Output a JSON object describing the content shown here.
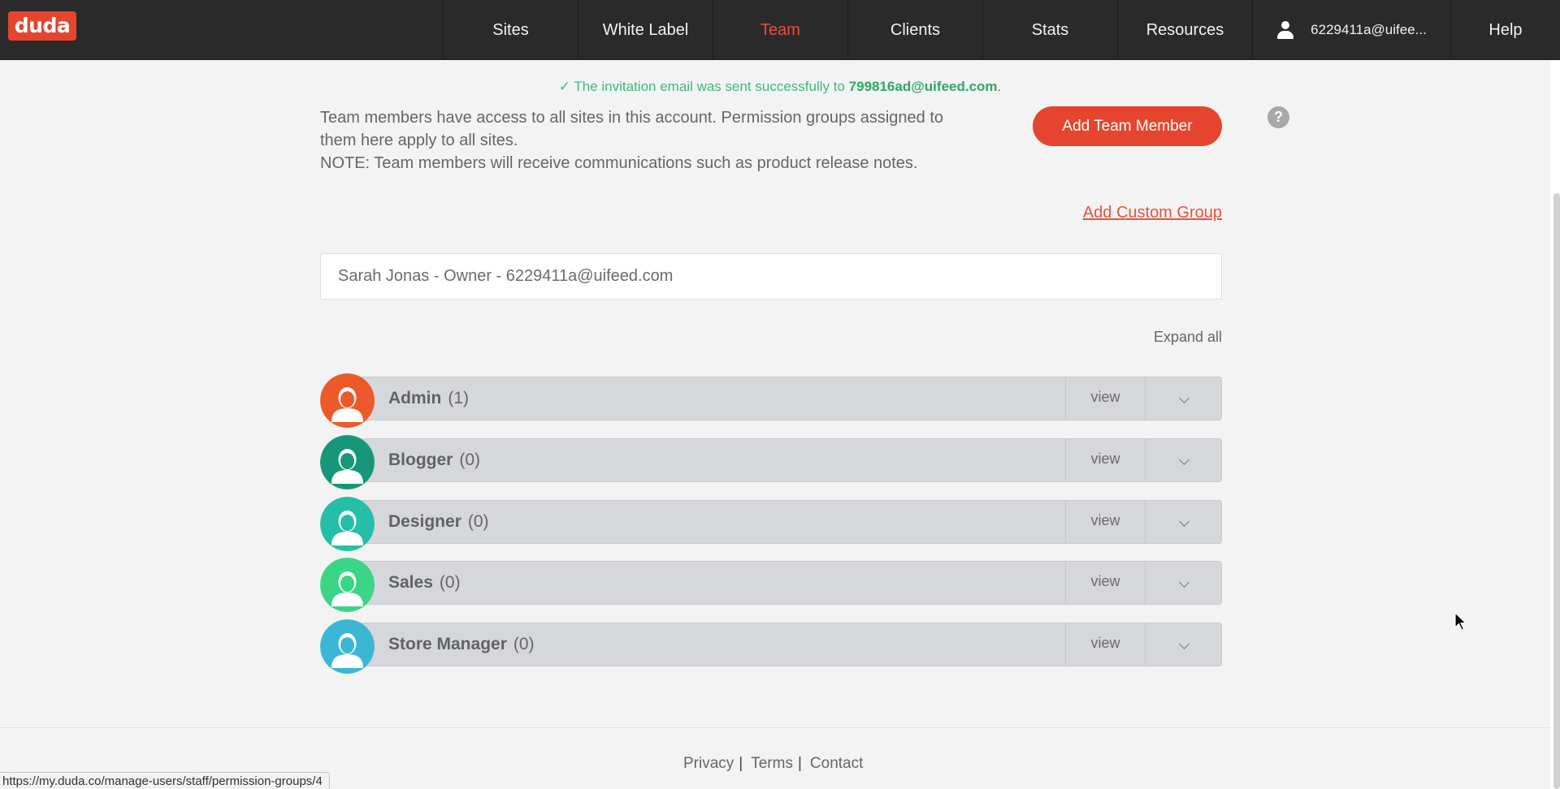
{
  "header": {
    "logo": "duda",
    "nav": [
      {
        "label": "Sites",
        "active": false
      },
      {
        "label": "White Label",
        "active": false
      },
      {
        "label": "Team",
        "active": true
      },
      {
        "label": "Clients",
        "active": false
      },
      {
        "label": "Stats",
        "active": false
      },
      {
        "label": "Resources",
        "active": false
      }
    ],
    "user_email": "6229411a@uifee...",
    "help_label": "Help",
    "user_icon": "user-icon"
  },
  "notice": {
    "check": "✓",
    "text": "The invitation email was sent successfully to ",
    "email": "799816ad@uifeed.com",
    "period": "."
  },
  "intro": {
    "line1": "Team members have access to all sites in this account. Permission groups assigned to them here apply to all sites.",
    "line2": "NOTE: Team members will receive communications such as product release notes."
  },
  "actions": {
    "add_team_member": "Add Team Member",
    "help_icon": "?",
    "add_custom_group": "Add Custom Group",
    "expand_all": "Expand all"
  },
  "owner": {
    "text": "Sarah Jonas - Owner - 6229411a@uifeed.com"
  },
  "groups": [
    {
      "name": "Admin",
      "count": "(1)",
      "view": "view",
      "color": "#ec5a2a"
    },
    {
      "name": "Blogger",
      "count": "(0)",
      "view": "view",
      "color": "#17977a"
    },
    {
      "name": "Designer",
      "count": "(0)",
      "view": "view",
      "color": "#25bfa8"
    },
    {
      "name": "Sales",
      "count": "(0)",
      "view": "view",
      "color": "#3bd586"
    },
    {
      "name": "Store Manager",
      "count": "(0)",
      "view": "view",
      "color": "#3bb7d6"
    }
  ],
  "footer": {
    "privacy": "Privacy",
    "terms": "Terms",
    "contact": "Contact",
    "sep": "|"
  },
  "status_bar": {
    "url": "https://my.duda.co/manage-users/staff/permission-groups/4"
  }
}
